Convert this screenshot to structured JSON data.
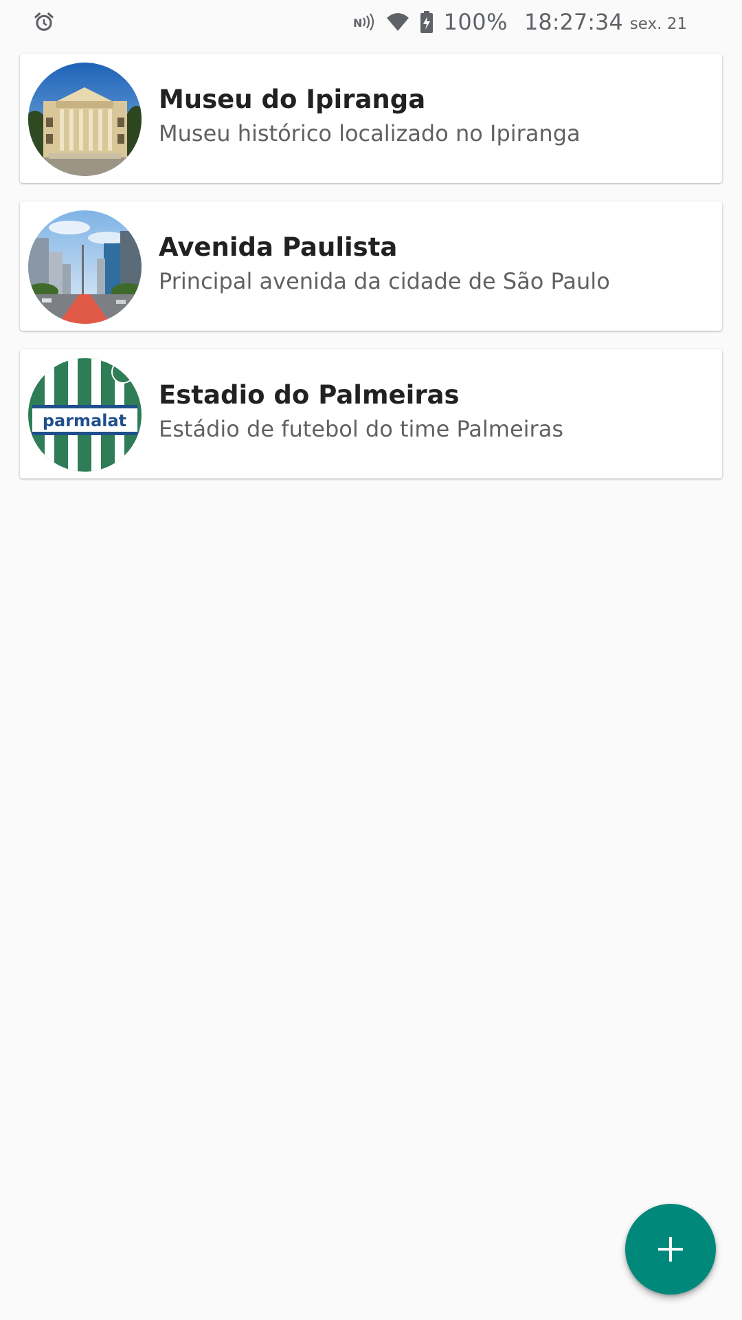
{
  "status_bar": {
    "alarm_icon": "alarm-clock-icon",
    "nfc_icon": "nfc-icon",
    "wifi_icon": "wifi-icon",
    "battery_icon": "battery-charging-icon",
    "battery_percent": "100%",
    "time": "18:27:34",
    "date": "sex. 21"
  },
  "places": [
    {
      "title": "Museu do Ipiranga",
      "subtitle": "Museu histórico localizado no Ipiranga",
      "image": "museum-building-photo"
    },
    {
      "title": "Avenida Paulista",
      "subtitle": "Principal avenida da cidade de São Paulo",
      "image": "avenue-street-photo"
    },
    {
      "title": "Estadio do Palmeiras",
      "subtitle": "Estádio de futebol do time Palmeiras",
      "image": "palmeiras-jersey-photo",
      "image_text": "parmalat"
    }
  ],
  "fab": {
    "icon": "plus-icon",
    "color": "#00897b"
  },
  "colors": {
    "background": "#fafafa",
    "card": "#ffffff",
    "title": "#212121",
    "subtitle": "#616161",
    "accent": "#00897b"
  }
}
